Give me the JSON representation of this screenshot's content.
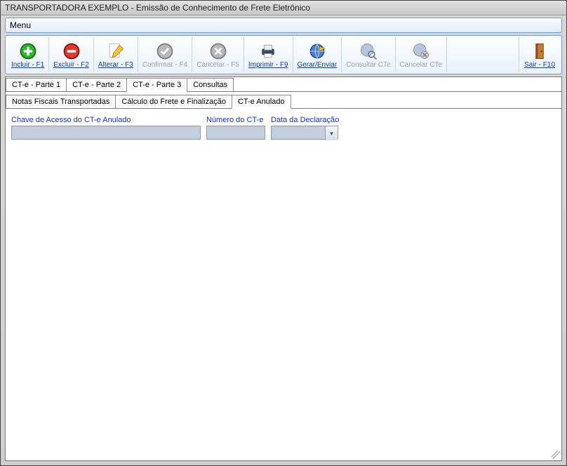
{
  "window": {
    "title": "TRANSPORTADORA EXEMPLO - Emissão de Conhecimento de Frete Eletrônico"
  },
  "menu": {
    "label": "Menu"
  },
  "toolbar": {
    "incluir": "Incluir - F1",
    "excluir": "Excluir - F2",
    "alterar": "Alterar - F3",
    "confirmar": "Confirmar - F4",
    "cancelar": "Cancelar - F5",
    "imprimir": "Imprimir - F9",
    "gerar": "Gerar/Enviar",
    "consultar": "Consultar CTe",
    "cancelar_cte": "Cancelar CTe",
    "sair": "Sair - F10"
  },
  "tabs_primary": [
    {
      "label": "CT-e - Parte 1"
    },
    {
      "label": "CT-e - Parte 2"
    },
    {
      "label": "CT-e - Parte 3",
      "active": true
    },
    {
      "label": "Consultas"
    }
  ],
  "tabs_secondary": [
    {
      "label": "Notas Fiscais Transportadas"
    },
    {
      "label": "Cálculo do Frete e Finalização"
    },
    {
      "label": "CT-e Anulado",
      "active": true
    }
  ],
  "fields": {
    "chave_label": "Chave de Acesso do CT-e Anulado",
    "chave_value": "",
    "numero_label": "Número do CT-e",
    "numero_value": "",
    "data_label": "Data da Declaração",
    "data_value": ""
  }
}
